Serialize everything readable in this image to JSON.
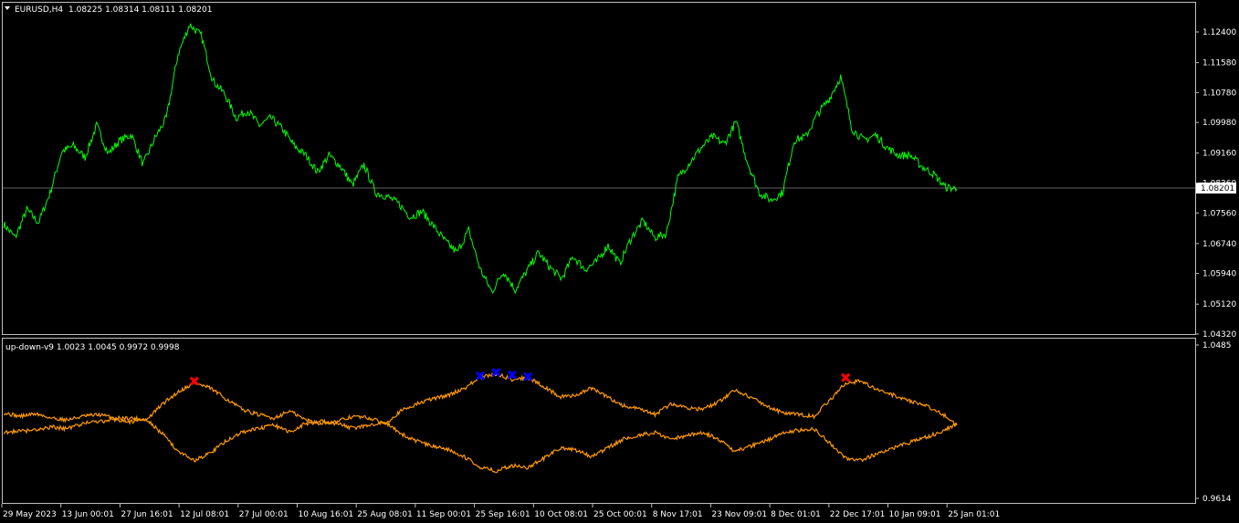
{
  "main_window": {
    "symbol_text": "EURUSD,H4",
    "ohlc_text": "1.08225 1.08314 1.08111 1.08201",
    "current_price_label": "1.08201",
    "price_axis_labels": [
      "1.12400",
      "1.11580",
      "1.10780",
      "1.09980",
      "1.09160",
      "1.08360",
      "1.07560",
      "1.06740",
      "1.05940",
      "1.05120",
      "1.04320"
    ]
  },
  "indicator_window": {
    "name_text": "up-down-v9 1.0023 1.0045 0.9972 0.9998",
    "axis_labels": [
      "1.0485",
      "0.9614"
    ]
  },
  "time_axis_labels": [
    "29 May 2023",
    "13 Jun 00:01",
    "27 Jun 16:01",
    "12 Jul 08:01",
    "27 Jul 00:01",
    "10 Aug 16:01",
    "25 Aug 08:01",
    "11 Sep 00:01",
    "25 Sep 16:01",
    "10 Oct 08:01",
    "25 Oct 00:01",
    "8 Nov 17:01",
    "23 Nov 09:01",
    "8 Dec 01:01",
    "22 Dec 17:01",
    "10 Jan 09:01",
    "25 Jan 01:01"
  ],
  "colors": {
    "background": "#000000",
    "price_line": "#00ff00",
    "indicator_line": "#ff9900",
    "marker_blue": "#0000ff",
    "marker_red": "#ff0000",
    "frame": "#c0c0c0"
  },
  "chart_data": [
    {
      "type": "line",
      "ylim": [
        1.0432,
        1.124
      ],
      "series": [
        {
          "color": "#00ff00",
          "values": [
            1.0726,
            1.069,
            1.0765,
            1.073,
            1.081,
            1.092,
            1.0935,
            1.0905,
            1.099,
            1.0915,
            1.095,
            1.0965,
            1.0885,
            1.0955,
            1.101,
            1.118,
            1.126,
            1.123,
            1.111,
            1.1075,
            1.101,
            1.103,
            1.099,
            1.101,
            1.098,
            1.0935,
            1.091,
            1.0865,
            1.091,
            1.088,
            1.083,
            1.0885,
            1.081,
            1.08,
            1.078,
            1.0745,
            1.076,
            1.072,
            1.068,
            1.065,
            1.071,
            1.0605,
            1.0545,
            1.06,
            1.055,
            1.06,
            1.065,
            1.061,
            1.058,
            1.064,
            1.0605,
            1.0625,
            1.067,
            1.062,
            1.069,
            1.0735,
            1.069,
            1.07,
            1.085,
            1.089,
            1.093,
            1.096,
            1.094,
            1.1,
            1.089,
            1.081,
            1.079,
            1.081,
            1.095,
            1.096,
            1.102,
            1.106,
            1.112,
            1.098,
            1.095,
            1.0965,
            1.093,
            1.091,
            1.091,
            1.088,
            1.086,
            1.0825,
            1.082
          ]
        }
      ]
    },
    {
      "type": "line",
      "ylim": [
        0.9614,
        1.0485
      ],
      "series": [
        {
          "color": "#ff9900",
          "values": [
            1.01,
            1.008,
            1.0095,
            1.007,
            1.006,
            1.008,
            1.009,
            1.007,
            1.007,
            1.006,
            1.015,
            1.022,
            1.027,
            1.024,
            1.018,
            1.012,
            1.009,
            1.007,
            1.011,
            1.006,
            1.004,
            1.005,
            1.008,
            1.007,
            1.004,
            1.011,
            1.015,
            1.018,
            1.02,
            1.024,
            1.03,
            1.032,
            1.029,
            1.03,
            1.025,
            1.019,
            1.02,
            1.024,
            1.019,
            1.014,
            1.012,
            1.009,
            1.015,
            1.013,
            1.012,
            1.016,
            1.023,
            1.019,
            1.014,
            1.01,
            1.009,
            1.008,
            1.017,
            1.027,
            1.028,
            1.023,
            1.02,
            1.017,
            1.014,
            1.01,
            1.003
          ]
        },
        {
          "color": "#ff9900",
          "values": [
            0.999,
            0.9995,
            1.0,
            1.002,
            1.001,
            1.004,
            1.005,
            1.006,
            1.005,
            1.006,
            0.998,
            0.988,
            0.983,
            0.987,
            0.994,
            0.999,
            1.001,
            1.003,
            0.999,
            1.004,
            1.005,
            1.004,
            1.001,
            1.003,
            1.005,
            0.998,
            0.994,
            0.991,
            0.989,
            0.985,
            0.979,
            0.977,
            0.98,
            0.979,
            0.984,
            0.99,
            0.989,
            0.985,
            0.99,
            0.995,
            0.997,
            0.999,
            0.995,
            0.997,
            0.999,
            0.995,
            0.988,
            0.991,
            0.994,
            0.999,
            1.0,
            1.001,
            0.993,
            0.984,
            0.983,
            0.987,
            0.99,
            0.993,
            0.996,
            0.999,
            1.004
          ]
        }
      ],
      "markers": [
        {
          "color": "#ff0000",
          "index": 12,
          "value": 1.028
        },
        {
          "color": "#0000ff",
          "index": 30,
          "value": 1.031
        },
        {
          "color": "#0000ff",
          "index": 31,
          "value": 1.033
        },
        {
          "color": "#0000ff",
          "index": 32,
          "value": 1.0315
        },
        {
          "color": "#0000ff",
          "index": 33,
          "value": 1.0305
        },
        {
          "color": "#ff0000",
          "index": 53,
          "value": 1.03
        }
      ]
    }
  ]
}
